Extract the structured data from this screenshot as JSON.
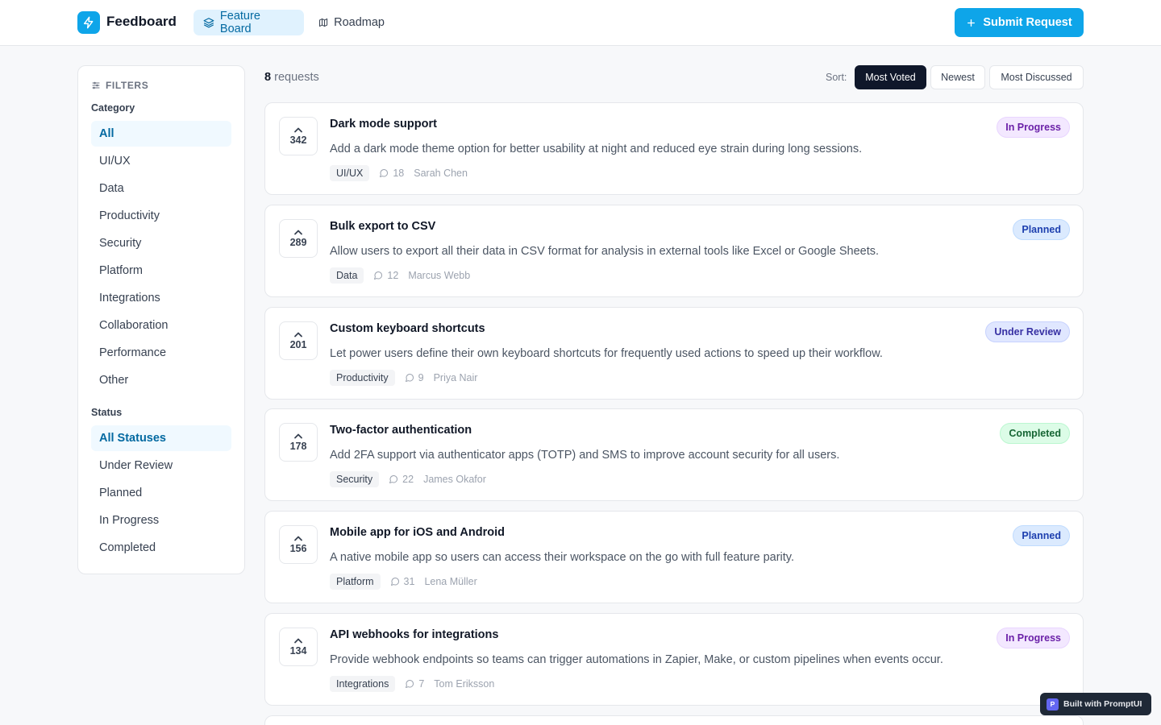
{
  "header": {
    "app_name": "Feedboard",
    "nav": [
      {
        "label": "Feature Board",
        "icon": "layers-icon",
        "active": true
      },
      {
        "label": "Roadmap",
        "icon": "map-icon",
        "active": false
      }
    ],
    "submit_label": "Submit Request"
  },
  "sidebar": {
    "title": "FILTERS",
    "category_label": "Category",
    "categories": [
      "All",
      "UI/UX",
      "Data",
      "Productivity",
      "Security",
      "Platform",
      "Integrations",
      "Collaboration",
      "Performance",
      "Other"
    ],
    "status_label": "Status",
    "statuses": [
      "All Statuses",
      "Under Review",
      "Planned",
      "In Progress",
      "Completed"
    ]
  },
  "main": {
    "count": "8",
    "count_suffix": "requests",
    "sort_label": "Sort:",
    "sort_options": [
      "Most Voted",
      "Newest",
      "Most Discussed"
    ],
    "requests": [
      {
        "votes": "342",
        "title": "Dark mode support",
        "description": "Add a dark mode theme option for better usability at night and reduced eye strain during long sessions.",
        "category": "UI/UX",
        "comments": "18",
        "author": "Sarah Chen",
        "status": "In Progress"
      },
      {
        "votes": "289",
        "title": "Bulk export to CSV",
        "description": "Allow users to export all their data in CSV format for analysis in external tools like Excel or Google Sheets.",
        "category": "Data",
        "comments": "12",
        "author": "Marcus Webb",
        "status": "Planned"
      },
      {
        "votes": "201",
        "title": "Custom keyboard shortcuts",
        "description": "Let power users define their own keyboard shortcuts for frequently used actions to speed up their workflow.",
        "category": "Productivity",
        "comments": "9",
        "author": "Priya Nair",
        "status": "Under Review"
      },
      {
        "votes": "178",
        "title": "Two-factor authentication",
        "description": "Add 2FA support via authenticator apps (TOTP) and SMS to improve account security for all users.",
        "category": "Security",
        "comments": "22",
        "author": "James Okafor",
        "status": "Completed"
      },
      {
        "votes": "156",
        "title": "Mobile app for iOS and Android",
        "description": "A native mobile app so users can access their workspace on the go with full feature parity.",
        "category": "Platform",
        "comments": "31",
        "author": "Lena Müller",
        "status": "Planned"
      },
      {
        "votes": "134",
        "title": "API webhooks for integrations",
        "description": "Provide webhook endpoints so teams can trigger automations in Zapier, Make, or custom pipelines when events occur.",
        "category": "Integrations",
        "comments": "7",
        "author": "Tom Eriksson",
        "status": "In Progress"
      }
    ]
  },
  "footer_badge": {
    "icon_letter": "P",
    "label": "Built with PromptUI"
  },
  "colors": {
    "accent": "#0ea5e9",
    "dark": "#0f172a"
  }
}
